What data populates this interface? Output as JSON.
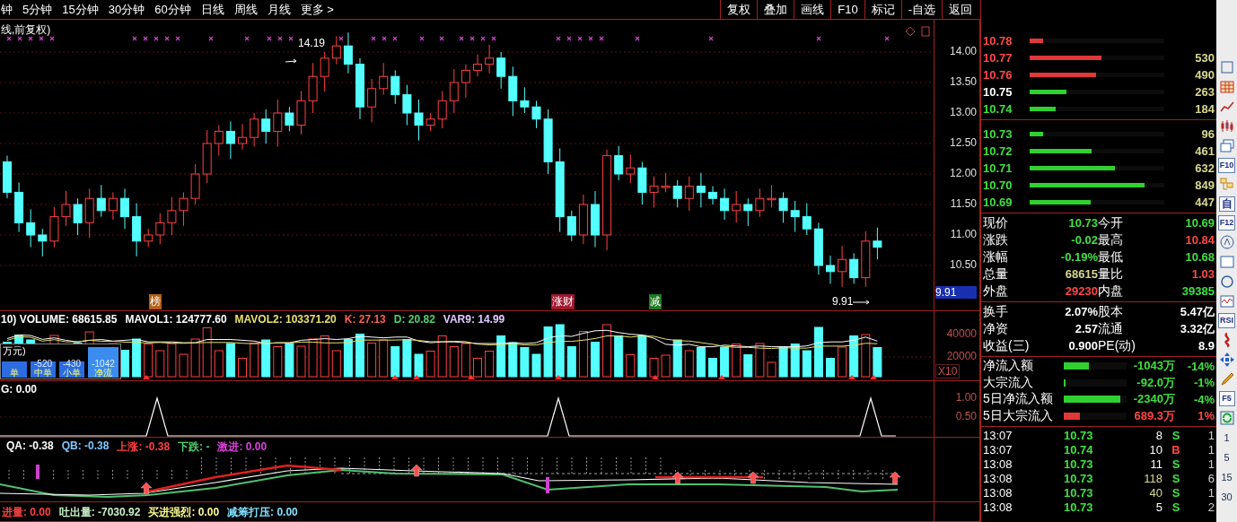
{
  "menu_bar": {
    "periods": [
      "钟",
      "5分钟",
      "15分钟",
      "30分钟",
      "60分钟",
      "日线",
      "周线",
      "月线",
      "更多 >"
    ],
    "buttons": [
      "复权",
      "叠加",
      "画线",
      "F10",
      "标记",
      "-自选",
      "返回"
    ]
  },
  "main_chart": {
    "title": "线,前复权)",
    "high_label": "14.19",
    "low_label": "9.91",
    "cursor_price": "9.91",
    "price_axis": [
      "14.00",
      "13.50",
      "13.00",
      "12.50",
      "12.00",
      "11.50",
      "11.00",
      "10.50"
    ],
    "signals": [
      {
        "label": "榜",
        "color": "#b06018"
      },
      {
        "label": "涨财",
        "color": "#a01830"
      },
      {
        "label": "减",
        "color": "#1e7a1e"
      }
    ]
  },
  "volume_panel": {
    "legend": [
      {
        "text": "10) VOLUME: 68615.85",
        "color": "#ffffff"
      },
      {
        "text": "MAVOL1: 124777.60",
        "color": "#ffffff"
      },
      {
        "text": "MAVOL2: 103371.20",
        "color": "#e8e070"
      },
      {
        "text": "K: 27.13",
        "color": "#ff6050"
      },
      {
        "text": "D: 20.82",
        "color": "#50d070"
      },
      {
        "text": "VAR9: 14.99",
        "color": "#e0c8ff"
      }
    ],
    "axis": [
      "40000",
      "20000"
    ],
    "scale_label": "X10",
    "flow_box": {
      "unit": "万元)",
      "cells": [
        {
          "kind": "small",
          "label": "单"
        },
        {
          "kind": "small",
          "value": "-520",
          "label": "中单"
        },
        {
          "kind": "small",
          "value": "-430",
          "label": "小单"
        },
        {
          "kind": "large",
          "value": "-1042",
          "label": "净流"
        }
      ]
    }
  },
  "kg_panel": {
    "legend": [
      {
        "text": "G: 0.00",
        "color": "#ffffff"
      }
    ],
    "axis": [
      "1.00",
      "0.50"
    ]
  },
  "qa_panel": {
    "legend": [
      {
        "text": "QA: -0.38",
        "color": "#ffffff"
      },
      {
        "text": "QB: -0.38",
        "color": "#80c8ff"
      },
      {
        "text": "上涨: -0.38",
        "color": "#ff4040"
      },
      {
        "text": "下跌: -",
        "color": "#50d070"
      },
      {
        "text": "激进: 0.00",
        "color": "#e040e0"
      }
    ]
  },
  "bottom_legend": [
    {
      "text": "进量: 0.00",
      "color": "#ff4040"
    },
    {
      "text": "吐出量: -7030.92",
      "color": "#c8f0c8"
    },
    {
      "text": "买进强烈: 0.00",
      "color": "#ffff90"
    },
    {
      "text": "减筹打压: 0.00",
      "color": "#80e0ff"
    }
  ],
  "order_book": {
    "asks": [
      {
        "price": "10.78",
        "color": "#ff4848",
        "bar": {
          "level": 0.1,
          "color": "#e03838"
        }
      },
      {
        "price": "10.77",
        "color": "#ff4848",
        "volume": "530",
        "bar": {
          "level": 0.53,
          "color": "#e03838"
        }
      },
      {
        "price": "10.76",
        "color": "#ff4848",
        "volume": "490",
        "bar": {
          "level": 0.49,
          "color": "#e03838"
        }
      },
      {
        "price": "10.75",
        "color": "#ffffff",
        "volume": "263",
        "bar": {
          "level": 0.27,
          "color": "#30d030"
        }
      },
      {
        "price": "10.74",
        "color": "#40e040",
        "volume": "184",
        "bar": {
          "level": 0.19,
          "color": "#30d030"
        }
      }
    ],
    "bids": [
      {
        "price": "10.73",
        "color": "#40e040",
        "volume": "96",
        "bar": {
          "level": 0.1,
          "color": "#30d030"
        }
      },
      {
        "price": "10.72",
        "color": "#40e040",
        "volume": "461",
        "bar": {
          "level": 0.46,
          "color": "#30d030"
        }
      },
      {
        "price": "10.71",
        "color": "#40e040",
        "volume": "632",
        "bar": {
          "level": 0.63,
          "color": "#30d030"
        }
      },
      {
        "price": "10.70",
        "color": "#40e040",
        "volume": "849",
        "bar": {
          "level": 0.85,
          "color": "#30d030"
        }
      },
      {
        "price": "10.69",
        "color": "#40e040",
        "volume": "447",
        "bar": {
          "level": 0.45,
          "color": "#30d030"
        }
      }
    ]
  },
  "quote": [
    [
      {
        "label": "现价",
        "value": "10.73",
        "color": "#40e040"
      },
      {
        "label": "今开",
        "value": "10.69",
        "color": "#40e040"
      }
    ],
    [
      {
        "label": "涨跌",
        "value": "-0.02",
        "color": "#40e040"
      },
      {
        "label": "最高",
        "value": "10.84",
        "color": "#ff4848"
      }
    ],
    [
      {
        "label": "涨幅",
        "value": "-0.19%",
        "color": "#40e040"
      },
      {
        "label": "最低",
        "value": "10.68",
        "color": "#40e040"
      }
    ],
    [
      {
        "label": "总量",
        "value": "68615",
        "color": "#d8d890"
      },
      {
        "label": "量比",
        "value": "1.03",
        "color": "#ff4848"
      }
    ],
    [
      {
        "label": "外盘",
        "value": "29230",
        "color": "#ff4848"
      },
      {
        "label": "内盘",
        "value": "39385",
        "color": "#40e040"
      }
    ]
  ],
  "stats": [
    [
      {
        "label": "换手",
        "value": "2.07%"
      },
      {
        "label": "股本",
        "value": "5.47亿"
      }
    ],
    [
      {
        "label": "净资",
        "value": "2.57"
      },
      {
        "label": "流通",
        "value": "3.32亿"
      }
    ],
    [
      {
        "label": "收益(三)",
        "value": "0.900"
      },
      {
        "label": "PE(动)",
        "value": "8.9"
      }
    ]
  ],
  "fund_flow": [
    {
      "label": "净流入额",
      "bar": {
        "level": 0.4,
        "color": "#30d030"
      },
      "amount": "-1043万",
      "percent": "-14%",
      "color": "#40e040"
    },
    {
      "label": "大宗流入",
      "bar": {
        "level": 0.03,
        "color": "#30d030"
      },
      "amount": "-92.0万",
      "percent": "-1%",
      "color": "#40e040"
    },
    {
      "label": "5日净流入额",
      "bar": {
        "level": 0.9,
        "color": "#30d030"
      },
      "amount": "-2340万",
      "percent": "-4%",
      "color": "#40e040"
    },
    {
      "label": "5日大宗流入",
      "bar": {
        "level": 0.26,
        "color": "#e03838"
      },
      "amount": "689.3万",
      "percent": "1%",
      "color": "#ff4848"
    }
  ],
  "ticks": [
    {
      "time": "13:07",
      "price": "10.73",
      "volume": "8",
      "big": false,
      "side": {
        "text": "S",
        "color": "#40e040"
      },
      "count": "1"
    },
    {
      "time": "13:07",
      "price": "10.74",
      "volume": "10",
      "big": false,
      "side": {
        "text": "B",
        "color": "#ff4848"
      },
      "count": "1"
    },
    {
      "time": "13:08",
      "price": "10.73",
      "volume": "11",
      "big": false,
      "side": {
        "text": "S",
        "color": "#40e040"
      },
      "count": "1"
    },
    {
      "time": "13:08",
      "price": "10.73",
      "volume": "118",
      "big": true,
      "side": {
        "text": "S",
        "color": "#40e040"
      },
      "count": "6"
    },
    {
      "time": "13:08",
      "price": "10.73",
      "volume": "40",
      "big": true,
      "side": {
        "text": "S",
        "color": "#40e040"
      },
      "count": "1"
    },
    {
      "time": "13:08",
      "price": "10.73",
      "volume": "5",
      "big": false,
      "side": {
        "text": "S",
        "color": "#40e040"
      },
      "count": "2"
    }
  ],
  "side_toolbar": {
    "labels": [
      "F10",
      "自",
      "F12",
      "RSI",
      "F5"
    ],
    "periods": [
      "1",
      "5",
      "15",
      "30"
    ]
  }
}
